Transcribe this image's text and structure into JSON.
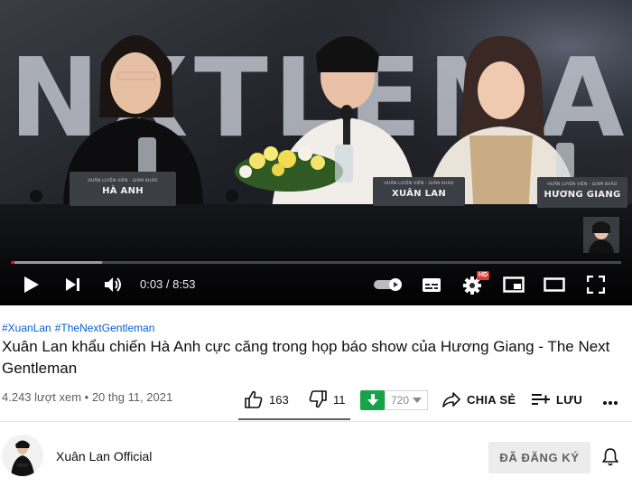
{
  "player": {
    "backdrop_text": "NXTLEMAN",
    "nameplates": [
      {
        "role": "HUẤN LUYỆN VIÊN - GIÁM KHẢO",
        "name": "HÀ ANH"
      },
      {
        "role": "HUẤN LUYỆN VIÊN - GIÁM KHẢO",
        "name": "XUÂN LAN"
      },
      {
        "role": "HUẤN LUYỆN VIÊN - GIÁM KHẢO",
        "name": "HƯƠNG GIANG"
      }
    ],
    "time_display": "0:03 / 8:53",
    "played_fraction": 0.006,
    "buffered_fraction": 0.15,
    "hd_badge": "HD",
    "icons": [
      "play-icon",
      "next-icon",
      "volume-icon",
      "autoplay-toggle-icon",
      "subtitles-icon",
      "settings-icon",
      "miniplayer-icon",
      "theater-mode-icon",
      "fullscreen-icon"
    ],
    "progress_color": "#ff0000"
  },
  "video": {
    "hashtags": [
      "#XuanLan",
      "#TheNextGentleman"
    ],
    "title": "Xuân Lan khẩu chiến Hà Anh cực căng trong họp báo show của Hương Giang - The Next Gentleman",
    "views_date": "4.243 lượt xem • 20 thg 11, 2021"
  },
  "actions": {
    "likes": "163",
    "dislikes": "11",
    "extension_count": "720",
    "share_label": "CHIA SẺ",
    "save_label": "LƯU"
  },
  "channel": {
    "name": "Xuân Lan Official",
    "subscribe_label": "ĐÃ ĐĂNG KÝ"
  },
  "colors": {
    "link": "#065fd4",
    "extension_green": "#16a34a"
  }
}
